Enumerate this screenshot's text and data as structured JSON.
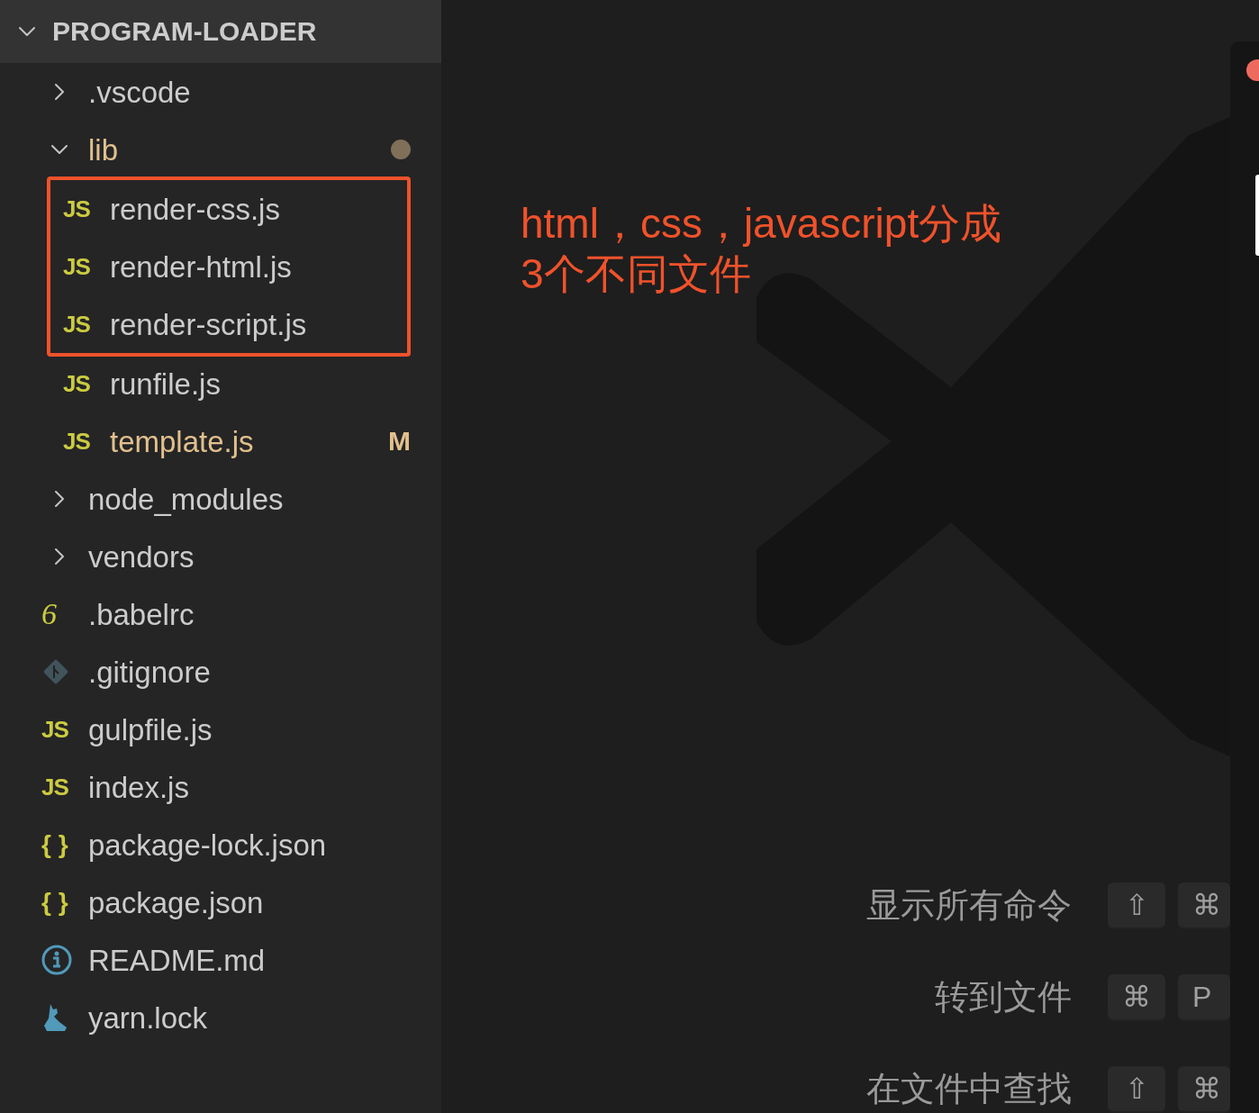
{
  "explorer": {
    "title": "PROGRAM-LOADER",
    "expanded": true,
    "items": [
      {
        "kind": "folder",
        "name": ".vscode",
        "expanded": false,
        "modified": false,
        "highlighted": false
      },
      {
        "kind": "folder",
        "name": "lib",
        "expanded": true,
        "modified": true,
        "highlighted": false,
        "children": [
          {
            "kind": "js",
            "icon_text": "JS",
            "name": "render-css.js",
            "modified": false,
            "highlighted": true
          },
          {
            "kind": "js",
            "icon_text": "JS",
            "name": "render-html.js",
            "modified": false,
            "highlighted": true
          },
          {
            "kind": "js",
            "icon_text": "JS",
            "name": "render-script.js",
            "modified": false,
            "highlighted": true
          },
          {
            "kind": "js",
            "icon_text": "JS",
            "name": "runfile.js",
            "modified": false,
            "highlighted": false
          },
          {
            "kind": "js",
            "icon_text": "JS",
            "name": "template.js",
            "modified": true,
            "badge": "M",
            "highlighted": false
          }
        ]
      },
      {
        "kind": "folder",
        "name": "node_modules",
        "expanded": false,
        "modified": false,
        "highlighted": false
      },
      {
        "kind": "folder",
        "name": "vendors",
        "expanded": false,
        "modified": false,
        "highlighted": false
      },
      {
        "kind": "babel",
        "icon_text": "6",
        "name": ".babelrc",
        "modified": false,
        "highlighted": false
      },
      {
        "kind": "git",
        "name": ".gitignore",
        "modified": false,
        "highlighted": false
      },
      {
        "kind": "js",
        "icon_text": "JS",
        "name": "gulpfile.js",
        "modified": false,
        "highlighted": false
      },
      {
        "kind": "js",
        "icon_text": "JS",
        "name": "index.js",
        "modified": false,
        "highlighted": false
      },
      {
        "kind": "json",
        "icon_text": "{ }",
        "name": "package-lock.json",
        "modified": false,
        "highlighted": false
      },
      {
        "kind": "json",
        "icon_text": "{ }",
        "name": "package.json",
        "modified": false,
        "highlighted": false
      },
      {
        "kind": "info",
        "name": "README.md",
        "modified": false,
        "highlighted": false
      },
      {
        "kind": "yarn",
        "name": "yarn.lock",
        "modified": false,
        "highlighted": false
      }
    ]
  },
  "annotation": {
    "lines": [
      "html，css，javascript分成",
      "3个不同文件"
    ]
  },
  "shortcuts": [
    {
      "label": "显示所有命令",
      "keys": [
        "⇧",
        "⌘"
      ]
    },
    {
      "label": "转到文件",
      "keys": [
        "⌘",
        "P"
      ]
    },
    {
      "label": "在文件中查找",
      "keys": [
        "⇧",
        "⌘"
      ]
    }
  ]
}
